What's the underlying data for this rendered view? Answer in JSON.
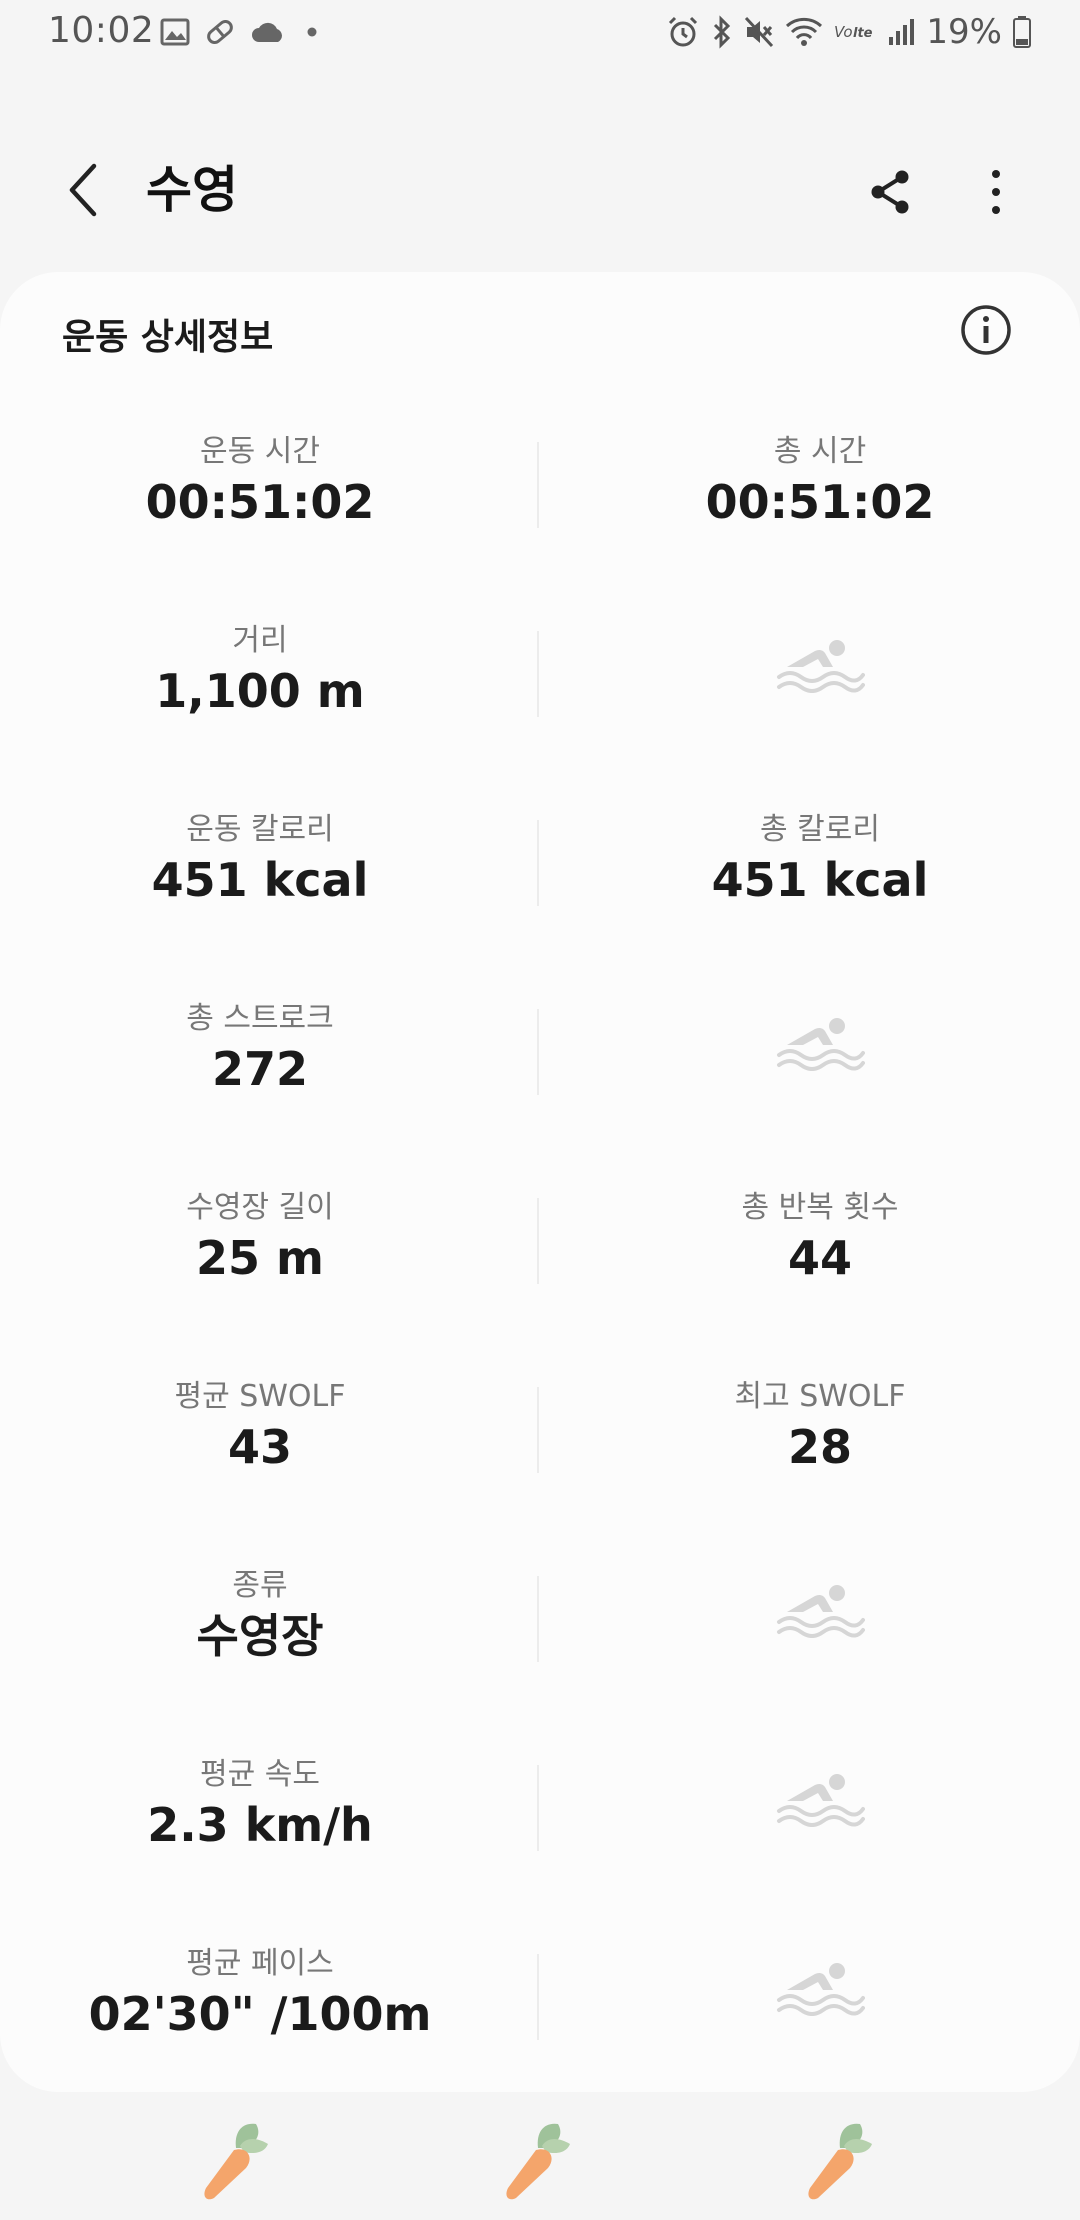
{
  "status_bar": {
    "time": "10:02",
    "battery": "19%",
    "left_icons": [
      "image-icon",
      "pill-icon",
      "cloud-icon",
      "dot-icon"
    ],
    "right_icons": [
      "alarm-icon",
      "bluetooth-icon",
      "mute-icon",
      "wifi-icon",
      "volte-icon",
      "signal-icon",
      "battery-icon"
    ],
    "volte_text": "Vo lte"
  },
  "app_bar": {
    "title": "수영"
  },
  "card": {
    "header": "운동 상세정보",
    "rows": [
      {
        "left": {
          "label": "운동 시간",
          "value": "00:51:02"
        },
        "right": {
          "label": "총 시간",
          "value": "00:51:02"
        }
      },
      {
        "left": {
          "label": "거리",
          "value": "1,100 m"
        },
        "right": null
      },
      {
        "left": {
          "label": "운동 칼로리",
          "value": "451 kcal"
        },
        "right": {
          "label": "총 칼로리",
          "value": "451 kcal"
        }
      },
      {
        "left": {
          "label": "총 스트로크",
          "value": "272"
        },
        "right": null
      },
      {
        "left": {
          "label": "수영장 길이",
          "value": "25 m"
        },
        "right": {
          "label": "총 반복 횟수",
          "value": "44"
        }
      },
      {
        "left": {
          "label": "평균 SWOLF",
          "value": "43"
        },
        "right": {
          "label": "최고 SWOLF",
          "value": "28"
        }
      },
      {
        "left": {
          "label": "종류",
          "value": "수영장"
        },
        "right": null
      },
      {
        "left": {
          "label": "평균 속도",
          "value": "2.3 km/h"
        },
        "right": null
      },
      {
        "left": {
          "label": "평균 페이스",
          "value": "02'30\" /100m"
        },
        "right": null
      }
    ]
  },
  "colors": {
    "background": "#f5f5f5",
    "card": "#fcfcfc",
    "label": "#777777",
    "value": "#1b1b1b",
    "placeholder_icon": "#d6d6d6",
    "carrot_orange": "#f4a56b",
    "carrot_leaf": "#9fc29a"
  },
  "bottom_icons": [
    "carrot-icon",
    "carrot-icon",
    "carrot-icon"
  ]
}
